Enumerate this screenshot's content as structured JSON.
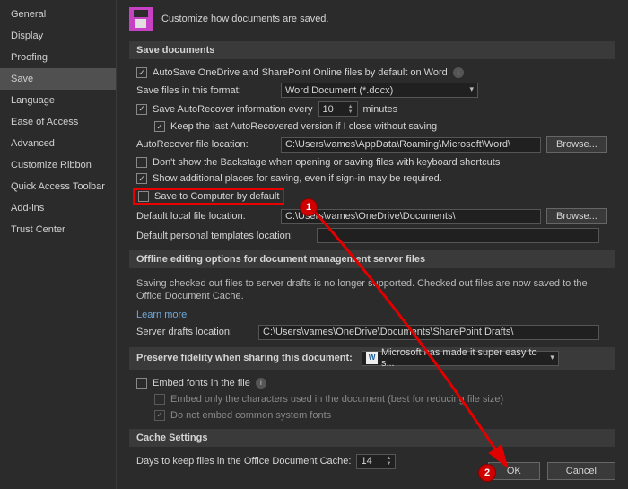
{
  "sidebar": {
    "items": [
      {
        "label": "General"
      },
      {
        "label": "Display"
      },
      {
        "label": "Proofing"
      },
      {
        "label": "Save",
        "selected": true
      },
      {
        "label": "Language"
      },
      {
        "label": "Ease of Access"
      },
      {
        "label": "Advanced"
      },
      {
        "label": "Customize Ribbon"
      },
      {
        "label": "Quick Access Toolbar"
      },
      {
        "label": "Add-ins"
      },
      {
        "label": "Trust Center"
      }
    ]
  },
  "header": {
    "title": "Customize how documents are saved."
  },
  "save_docs": {
    "section": "Save documents",
    "autosave": "AutoSave OneDrive and SharePoint Online files by default on Word",
    "save_format_lbl": "Save files in this format:",
    "save_format_val": "Word Document (*.docx)",
    "autorecover_lbl": "Save AutoRecover information every",
    "autorecover_val": "10",
    "autorecover_min": "minutes",
    "keep_last": "Keep the last AutoRecovered version if I close without saving",
    "ar_loc_lbl": "AutoRecover file location:",
    "ar_loc_val": "C:\\Users\\vames\\AppData\\Roaming\\Microsoft\\Word\\",
    "browse": "Browse...",
    "dont_show": "Don't show the Backstage when opening or saving files with keyboard shortcuts",
    "show_places": "Show additional places for saving, even if sign-in may be required.",
    "save_pc": "Save to Computer by default",
    "def_loc_lbl": "Default local file location:",
    "def_loc_val": "C:\\Users\\vames\\OneDrive\\Documents\\",
    "def_tmpl_lbl": "Default personal templates location:",
    "def_tmpl_val": ""
  },
  "offline": {
    "section": "Offline editing options for document management server files",
    "desc": "Saving checked out files to server drafts is no longer supported. Checked out files are now saved to the Office Document Cache.",
    "learn": "Learn more",
    "drafts_lbl": "Server drafts location:",
    "drafts_val": "C:\\Users\\vames\\OneDrive\\Documents\\SharePoint Drafts\\"
  },
  "preserve": {
    "section": "Preserve fidelity when sharing this document:",
    "doc_val": "Microsoft has made it super easy to s...",
    "embed": "Embed fonts in the file",
    "embed_only": "Embed only the characters used in the document (best for reducing file size)",
    "no_common": "Do not embed common system fonts"
  },
  "cache": {
    "section": "Cache Settings",
    "days_lbl": "Days to keep files in the Office Document Cache:",
    "days_val": "14"
  },
  "footer": {
    "ok": "OK",
    "cancel": "Cancel"
  },
  "callouts": {
    "c1": "1",
    "c2": "2"
  }
}
